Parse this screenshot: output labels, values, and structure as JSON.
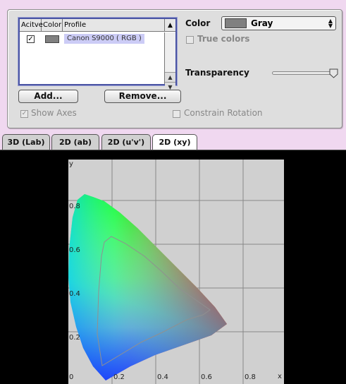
{
  "list": {
    "headers": [
      "Acitve",
      "Color",
      "Profile"
    ],
    "rows": [
      {
        "active": true,
        "swatch_color": "#808080",
        "profile": "Canon S9000 ( RGB )"
      }
    ],
    "sort_icon": "triangle-up"
  },
  "buttons": {
    "add": "Add...",
    "remove": "Remove..."
  },
  "options": {
    "show_axes": "Show Axes",
    "show_axes_checked": true,
    "constrain_rotation": "Constrain Rotation",
    "constrain_rotation_checked": false,
    "color_label": "Color",
    "color_value": "Gray",
    "color_swatch": "#808080",
    "true_colors": "True colors",
    "true_colors_checked": false,
    "transparency_label": "Transparency",
    "transparency_level": 1.0
  },
  "tabs": [
    {
      "label": "3D (Lab)",
      "active": false
    },
    {
      "label": "2D (ab)",
      "active": false
    },
    {
      "label": "2D (u'v')",
      "active": false
    },
    {
      "label": "2D (xy)",
      "active": true
    }
  ],
  "plot": {
    "x_axis_label": "x",
    "y_axis_label": "y",
    "x_ticks": [
      "0",
      "0.2",
      "0.4",
      "0.6",
      "0.8"
    ],
    "y_ticks": [
      "0.2",
      "0.4",
      "0.6",
      "0.8"
    ],
    "gamut_outline_color": "#909090"
  }
}
